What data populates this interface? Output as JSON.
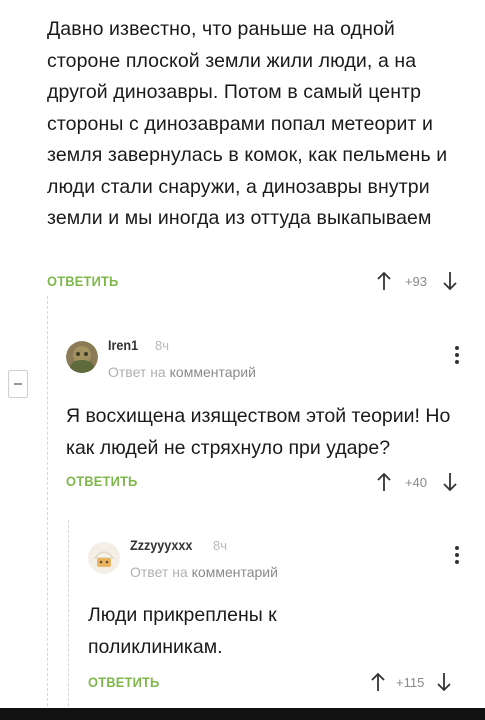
{
  "comments": [
    {
      "text": "Давно известно, что раньше на одной стороне плоской земли жили люди, а на другой динозавры. Потом в самый центр стороны с динозаврами попал метеорит и земля завернулась в комок, как пельмень и люди стали снаружи, а динозавры внутри земли и мы иногда из оттуда выкапываем",
      "reply_label": "ОТВЕТИТЬ",
      "rating": "+93"
    },
    {
      "username": "Iren1",
      "time": "8ч",
      "reply_prefix": "Ответ на",
      "reply_link": "комментарий",
      "text": "Я восхищена изяществом этой теории! Но как людей не стряхнуло при ударе?",
      "reply_label": "ОТВЕТИТЬ",
      "rating": "+40"
    },
    {
      "username": "Zzzyyyxxx",
      "time": "8ч",
      "reply_prefix": "Ответ на",
      "reply_link": "комментарий",
      "text": "Люди прикреплены к поликлиникам.",
      "reply_label": "ОТВЕТИТЬ",
      "rating": "+115"
    }
  ],
  "icons": {
    "upvote": "arrow-up-icon",
    "downvote": "arrow-down-icon",
    "more": "more-vertical-icon",
    "collapse": "collapse-icon"
  },
  "colors": {
    "reply_button": "#7fb84a",
    "rating_text": "#8a8a8a"
  }
}
